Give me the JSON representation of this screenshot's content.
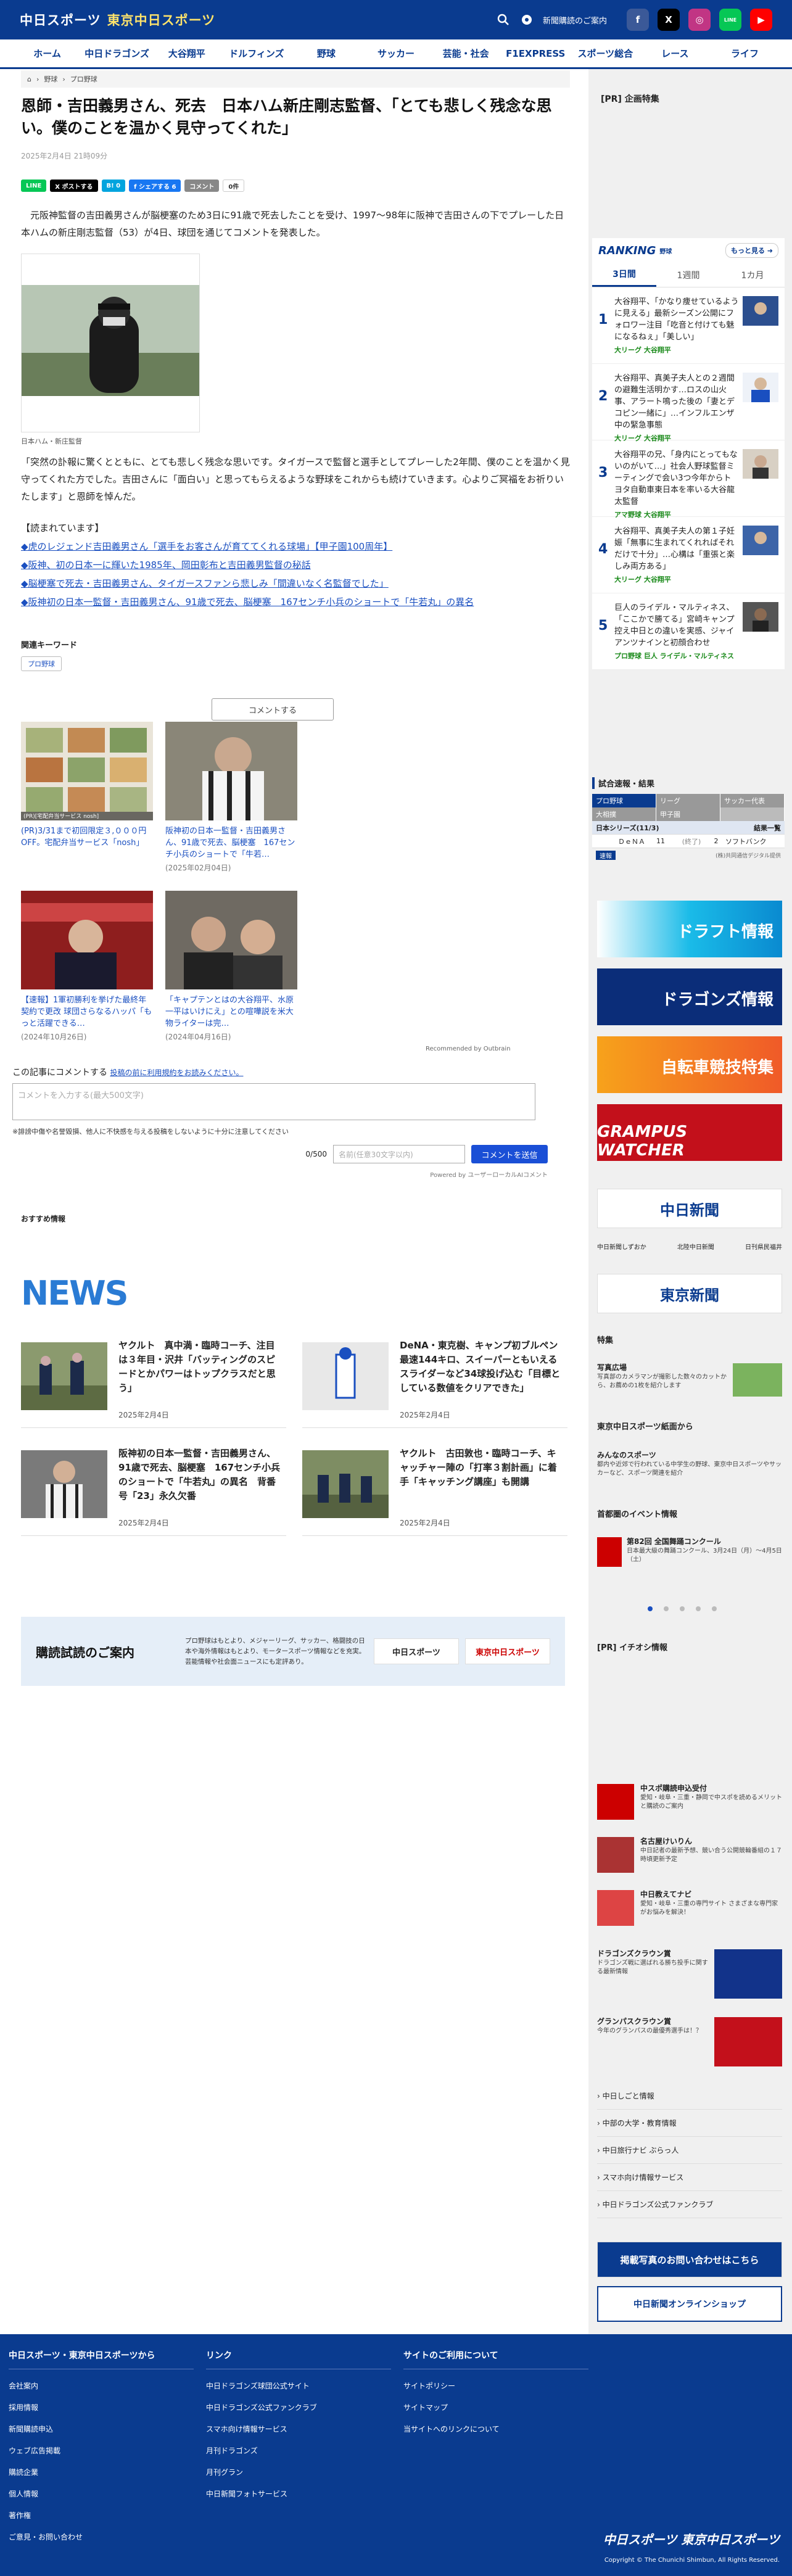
{
  "header": {
    "logo_left": "中日スポーツ",
    "logo_right": "東京中日スポーツ",
    "member": "新聞購読のご案内",
    "sns": [
      "f",
      "X",
      "◎",
      "LINE",
      "▶"
    ]
  },
  "nav": [
    "ホーム",
    "中日ドラゴンズ",
    "大谷翔平",
    "ドルフィンズ",
    "野球",
    "サッカー",
    "芸能・社会",
    "F1EXPRESS",
    "スポーツ総合",
    "レース",
    "ライフ"
  ],
  "breadcrumb": [
    "野球",
    "プロ野球"
  ],
  "article": {
    "title": "恩師・吉田義男さん、死去　日本ハム新庄剛志監督、「とても悲しく残念な思い。僕のことを温かく見守ってくれた」",
    "date": "2025年2月4日 21時09分",
    "share": [
      "LINE",
      "X ポストする",
      "B! 0",
      "f シェアする 6",
      "コメント",
      "0件"
    ],
    "lead": "元阪神監督の吉田義男さんが脳梗塞のため3日に91歳で死去したことを受け、1997〜98年に阪神で吉田さんの下でプレーした日本ハムの新庄剛志監督（53）が4日、球団を通じてコメントを発表した。",
    "caption": "日本ハム・新庄監督",
    "body": "「突然の訃報に驚くとともに、とても悲しく残念な思いです。タイガースで監督と選手としてプレーした2年間、僕のことを温かく見守ってくれた方でした。吉田さんに「面白い」と思ってもらえるような野球をこれからも続けていきます。心よりご冥福をお祈りいたします」と恩師を悼んだ。",
    "related_title": "【読まれています】",
    "related": [
      "◆虎のレジェンド吉田義男さん「選手をお客さんが育ててくれる球場」【甲子園100周年】",
      "◆阪神、初の日本一に輝いた1985年、岡田彰布と吉田義男監督の秘話",
      "◆脳梗塞で死去・吉田義男さん、タイガースファンら悲しみ「間違いなく名監督でした」",
      "◆阪神初の日本一監督・吉田義男さん、91歳で死去、脳梗塞　167センチ小兵のショートで「牛若丸」の異名"
    ]
  },
  "keywords": {
    "title": "関連キーワード",
    "tag": "プロ野球"
  },
  "comment_button": "コメントする",
  "recommend": [
    {
      "title": "(PR)3/31まで初回限定３,０００円OFF。宅配弁当サービス「nosh」",
      "date": "",
      "caption": "(PR)[宅配弁当サービス nosh]"
    },
    {
      "title": "阪神初の日本一監督・吉田義男さん、91歳で死去、脳梗塞　167センチ小兵のショートで「牛若…",
      "date": "(2025年02月04日)"
    },
    {
      "title": "【速報】1軍初勝利を挙げた最終年契約で更改 球団さらなるハッパ「もっと活躍できる…",
      "date": "(2024年10月26日)"
    },
    {
      "title": "「キャプテンとはの大谷翔平、水原一平はいけにえ」との喧嘩説を米大物ライターは完…",
      "date": "(2024年04月16日)"
    }
  ],
  "outbrain": "Recommended by Outbrain",
  "comment_form": {
    "label": "この記事にコメントする",
    "rules": "投稿の前に利用規約をお読みください。",
    "placeholder": "コメントを入力する(最大500文字)",
    "warning": "※誹謗中傷や名誉毀損、他人に不快感を与える投稿をしないように十分に注意してください",
    "count": "0/500",
    "name_placeholder": "名前(任意30文字以内)",
    "submit": "コメントを送信",
    "powered": "Powered by ユーザーローカルAIコメント"
  },
  "recommend_info": "おすすめ情報",
  "news": {
    "heading": "NEWS",
    "items": [
      {
        "title": "ヤクルト　真中満・臨時コーチ、注目は３年目・沢井「バッティングのスピードとかパワーはトップクラスだと思う」",
        "date": "2025年2月4日"
      },
      {
        "title": "DeNA・東克樹、キャンプ初ブルペン　最速144キロ、スイーパーともいえるスライダーなど34球投げ込む「目標としている数値をクリアできた」",
        "date": "2025年2月4日"
      },
      {
        "title": "阪神初の日本一監督・吉田義男さん、91歳で死去、脳梗塞　167センチ小兵のショートで「牛若丸」の異名　背番号「23」永久欠番",
        "date": "2025年2月4日"
      },
      {
        "title": "ヤクルト　古田敦也・臨時コーチ、キャッチャー陣の「打率３割計画」に着手「キャッチング講座」も開講",
        "date": "2025年2月4日"
      }
    ]
  },
  "subscribe": {
    "heading": "購読試読のご案内",
    "text": "プロ野球はもとより、メジャーリーグ、サッカー、格闘技の日本や海外情報はもとより、モータースポーツ情報などを充実。芸能情報や社会面ニュースにも定評あり。",
    "logos": [
      "中日スポーツ",
      "東京中日スポーツ"
    ]
  },
  "sidebar": {
    "pr": "[PR] 企画特集",
    "ranking": {
      "title": "RANKING",
      "sub": "野球",
      "more": "もっと見る ➜",
      "tabs": [
        "3日間",
        "1週間",
        "1カ月"
      ],
      "items": [
        {
          "n": "1",
          "text": "大谷翔平、「かなり痩せているように見える」最新シーズン公開にフォロワー注目「吃音と付けても魅になるねぇ」「美しい」",
          "tags": "大リーグ 大谷翔平"
        },
        {
          "n": "2",
          "text": "大谷翔平、真美子夫人との２週間の避難生活明かす…ロスの山火事、アラート鳴った後の「妻とデコピン一緒に」…インフルエンザ中の緊急事態",
          "tags": "大リーグ 大谷翔平"
        },
        {
          "n": "3",
          "text": "大谷翔平の兄、「身内にとってもないのがいて…」社会人野球監督ミーティングで会い3つ今年からトヨタ自動車東日本を率いる大谷龍太監督",
          "tags": "アマ野球 大谷翔平"
        },
        {
          "n": "4",
          "text": "大谷翔平、真美子夫人の第１子妊娠「無事に生まれてくれればそれだけで十分」…心構は「重張と楽しみ両方ある」",
          "tags": "大リーグ 大谷翔平"
        },
        {
          "n": "5",
          "text": "巨人のライデル・マルティネス、「ここかで勝てる」宮崎キャンプ控え中日との違いを実感、ジャイアンツナインと初顔合わせ",
          "tags": "プロ野球 巨人 ライデル・マルティネス"
        }
      ]
    },
    "score": {
      "title": "試合速報・結果",
      "tabs": [
        "プロ野球",
        "リーグ",
        "サッカー代表"
      ],
      "tabs2": [
        "大相撲",
        "甲子園"
      ],
      "series": "日本シリーズ(11/3)",
      "result_link": "結果一覧",
      "row": [
        "ＤｅＮＡ",
        "11",
        "(終了)",
        "2",
        "ソフトバンク"
      ],
      "note": "(株)共同通信デジタル提供",
      "badge": "速報"
    },
    "banners": [
      "ドラフト情報",
      "ドラゴンズ情報",
      "自転車競技特集",
      "GRAMPUS WATCHER"
    ],
    "chunichi": "中日新聞",
    "tri": [
      "中日新聞しずおか",
      "北陸中日新聞",
      "日刊県民福井"
    ],
    "tokyo": "東京新聞",
    "feature": {
      "label": "特集",
      "title": "写真広場",
      "text": "写真部のカメラマンが撮影した数々のカットから、お薦めの1枚を紹介します"
    },
    "tokyo_sports": {
      "label": "東京中日スポーツ紙面から",
      "title": "みんなのスポーツ",
      "text": "都内や近郊で行われている中学生の野球、東京中日スポーツやサッカーなど、スポーツ関連を紹介"
    },
    "events": {
      "label": "首都圏のイベント情報",
      "title": "第82回 全国舞踊コンクール",
      "text": "日本最大級の舞踊コンクール、3月24日（月）〜4月5日（土）"
    },
    "pr2": "[PR] イチオシ情報",
    "services": [
      {
        "title": "中スポ購読申込受付",
        "text": "愛知・岐阜・三重・静岡で中スポを読めるメリットと購読のご案内"
      },
      {
        "title": "名古屋けいりん",
        "text": "中日記者の最新予想、競い合う公開競輪番組の１７時頃更新予定"
      },
      {
        "title": "中日教えてナビ",
        "text": "愛知・岐阜・三重の専門サイト さまざまな専門家がお悩みを解決！"
      },
      {
        "title": "ドラゴンズクラウン賞",
        "text": "ドラゴンズ戦に選ばれる勝ち投手に関する最新情報"
      },
      {
        "title": "グランパスクラウン賞",
        "text": "今年のグランパスの最優秀選手は！？"
      }
    ],
    "links": [
      "› 中日しごと情報",
      "› 中部の大学・教育情報",
      "› 中日旅行ナビ ぶらっ人",
      "› スマホ向け情報サービス",
      "› 中日ドラゴンズ公式ファンクラブ"
    ],
    "photo": "掲載写真のお問い合わせはこちら",
    "shop": "中日新聞オンラインショップ"
  },
  "footer": {
    "col1": "中日スポーツ・東京中日スポーツから",
    "col1_items": [
      "会社案内",
      "採用情報",
      "新聞購読申込",
      "ウェブ広告掲載",
      "購読企業",
      "個人情報",
      "著作権",
      "ご意見・お問い合わせ"
    ],
    "col2": "リンク",
    "col2_items": [
      "中日ドラゴンズ球団公式サイト",
      "中日ドラゴンズ公式ファンクラブ",
      "スマホ向け情報サービス",
      "月刊ドラゴンズ",
      "月刊グラン",
      "中日新聞フォトサービス"
    ],
    "col3": "サイトのご利用について",
    "col3_items": [
      "サイトポリシー",
      "サイトマップ",
      "当サイトへのリンクについて"
    ],
    "logo": "中日スポーツ 東京中日スポーツ",
    "copy": "Copyright © The Chunichi Shimbun, All Rights Reserved."
  },
  "colors": {
    "brand": "#0a3b8f",
    "link": "#1a4fc0",
    "rank_tag": "#1a8a1a"
  }
}
